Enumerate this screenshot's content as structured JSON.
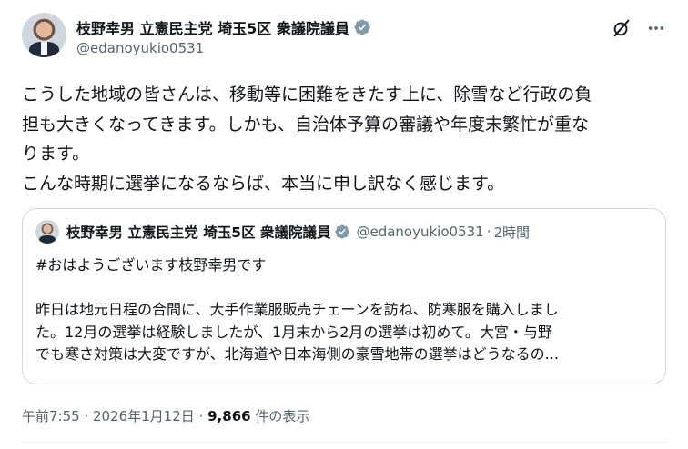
{
  "author": {
    "display_name": "枝野幸男 立憲民主党 埼玉5区 衆議院議員",
    "handle": "@edanoyukio0531"
  },
  "post": {
    "lines": [
      "こうした地域の皆さんは、移動等に困難をきたす上に、除雪など行政の負",
      "担も大きくなってきます。しかも、自治体予算の審議や年度末繁忙が重な",
      "ります。",
      "こんな時期に選挙になるならば、本当に申し訳なく感じます。"
    ]
  },
  "quote": {
    "display_name": "枝野幸男 立憲民主党 埼玉5区 衆議院議員",
    "handle": "@edanoyukio0531",
    "separator": "·",
    "time": "2時間",
    "hashtag_line": "#おはようございます枝野幸男です",
    "lines": [
      "昨日は地元日程の合間に、大手作業服販売チェーンを訪ね、防寒服を購入しまし",
      "た。12月の選挙は経験しましたが、1月末から2月の選挙は初めて。大宮・与野",
      "でも寒さ対策は大変ですが、北海道や日本海側の豪雪地帯の選挙はどうなるの..."
    ]
  },
  "meta": {
    "time": "午前7:55",
    "sep1": " · ",
    "date": "2026年1月12日",
    "sep2": " · ",
    "views_count": "9,866",
    "views_label": " 件の表示"
  },
  "icons": {
    "verified": "verified-badge-icon",
    "grok": "grok-icon",
    "more": "more-icon"
  },
  "colors": {
    "verified": "#829aab",
    "secondary_text": "#536471",
    "primary_text": "#0f1419",
    "border": "#cfd9de"
  }
}
